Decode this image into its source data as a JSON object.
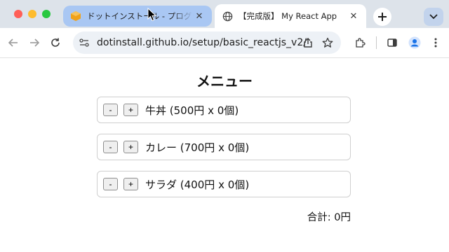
{
  "browser": {
    "tabs": [
      {
        "title": "ドットインストール - プログラミ",
        "active": false
      },
      {
        "title": "【完成版】 My React App",
        "active": true
      }
    ],
    "url": "dotinstall.github.io/setup/basic_reactjs_v2/"
  },
  "page": {
    "heading": "メニュー",
    "items": [
      {
        "name": "牛丼",
        "price": "500",
        "count": "0"
      },
      {
        "name": "カレー",
        "price": "700",
        "count": "0"
      },
      {
        "name": "サラダ",
        "price": "400",
        "count": "0"
      }
    ],
    "minus_label": "-",
    "plus_label": "+",
    "currency": "円",
    "times": "x",
    "count_unit": "個",
    "total_label": "合計:",
    "total_value": "0"
  },
  "colors": {
    "tabbar": "#dde3ea",
    "inactive_tab": "#a9c7f3",
    "active_tab": "#ffffff",
    "omnibox": "#edf1f6",
    "profile": "#1a73e8"
  }
}
